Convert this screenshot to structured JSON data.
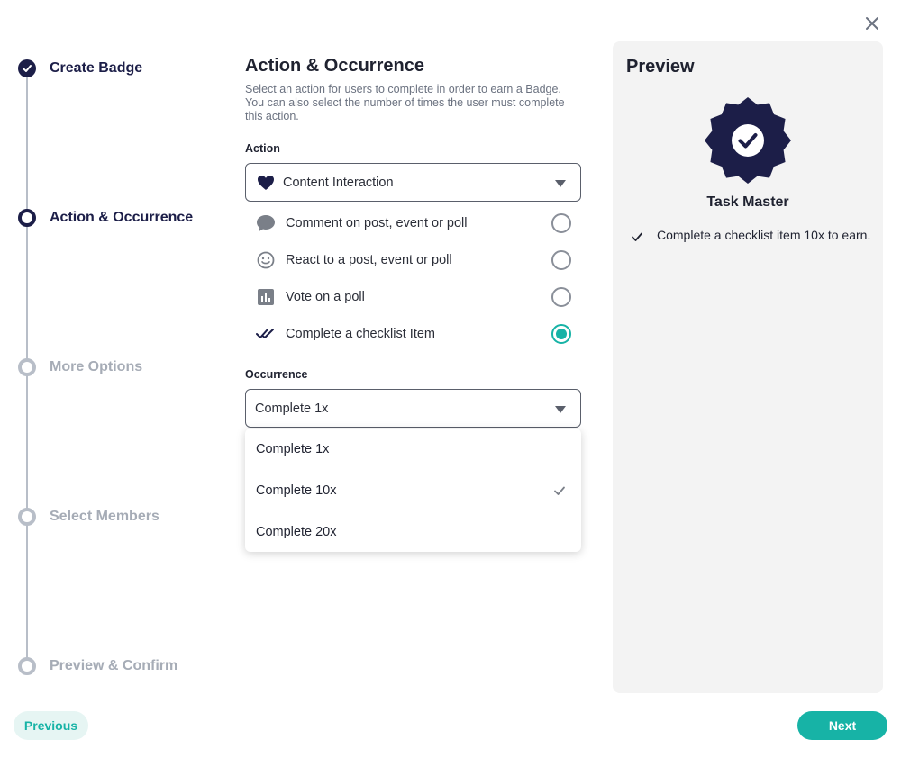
{
  "colors": {
    "navy": "#1c1e48",
    "teal": "#17b3a6",
    "teal_light": "#e6f5f3",
    "inactive": "#a6acb6",
    "panel_bg": "#f3f3f3"
  },
  "stepper": {
    "steps": [
      {
        "label": "Create Badge",
        "state": "done"
      },
      {
        "label": "Action & Occurrence",
        "state": "current"
      },
      {
        "label": "More Options",
        "state": "todo"
      },
      {
        "label": "Select Members",
        "state": "todo"
      },
      {
        "label": "Preview & Confirm",
        "state": "todo"
      }
    ]
  },
  "main": {
    "title": "Action & Occurrence",
    "description": "Select an action for users to complete in order to earn a Badge. You can also select the number of times the user must complete this action.",
    "action_label": "Action",
    "action_select": {
      "value": "Content Interaction",
      "icon": "heart-icon"
    },
    "action_options": [
      {
        "label": "Comment on post, event or poll",
        "icon": "comment-icon",
        "checked": false
      },
      {
        "label": "React to a post, event or poll",
        "icon": "smiley-icon",
        "checked": false
      },
      {
        "label": "Vote on a poll",
        "icon": "poll-icon",
        "checked": false
      },
      {
        "label": "Complete a checklist Item",
        "icon": "double-check-icon",
        "checked": true
      }
    ],
    "occurrence_label": "Occurrence",
    "occurrence_select": {
      "value": "Complete 1x"
    },
    "occurrence_options": [
      {
        "label": "Complete 1x",
        "selected": false
      },
      {
        "label": "Complete 10x",
        "selected": true
      },
      {
        "label": "Complete 20x",
        "selected": false
      }
    ]
  },
  "preview": {
    "title": "Preview",
    "badge_name": "Task Master",
    "requirement": "Complete a checklist item 10x to earn."
  },
  "footer": {
    "previous_label": "Previous",
    "next_label": "Next"
  }
}
